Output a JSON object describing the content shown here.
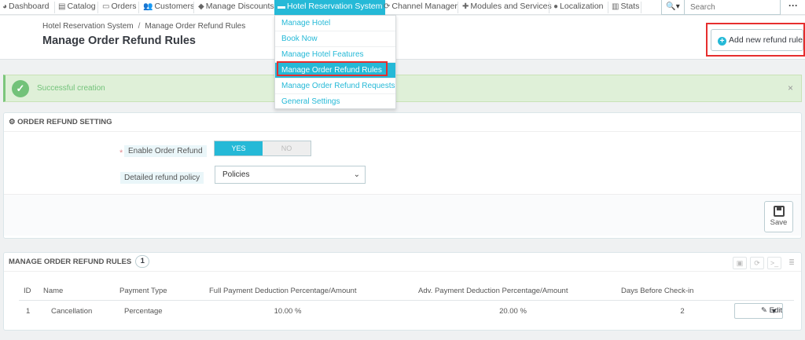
{
  "nav": {
    "items": [
      {
        "label": "Dashboard",
        "icon": "dashboard-icon",
        "glyph": "◕"
      },
      {
        "label": "Catalog",
        "icon": "catalog-icon",
        "glyph": "▤"
      },
      {
        "label": "Orders",
        "icon": "orders-icon",
        "glyph": "▭"
      },
      {
        "label": "Customers",
        "icon": "customers-icon",
        "glyph": "👥"
      },
      {
        "label": "Manage Discounts",
        "icon": "tag-icon",
        "glyph": "◆"
      },
      {
        "label": "Hotel Reservation System",
        "icon": "bed-icon",
        "glyph": "▬"
      },
      {
        "label": "Channel Manager",
        "icon": "refresh-icon",
        "glyph": "⟳"
      },
      {
        "label": "Modules and Services",
        "icon": "puzzle-icon",
        "glyph": "✚"
      },
      {
        "label": "Localization",
        "icon": "globe-icon",
        "glyph": "●"
      },
      {
        "label": "Stats",
        "icon": "bar-chart-icon",
        "glyph": "▥"
      }
    ],
    "search_placeholder": "Search",
    "search_icon": "🔍▾",
    "more_icon": "···"
  },
  "dropdown": {
    "items": [
      "Manage Hotel",
      "Book Now",
      "Manage Hotel Features",
      "Manage Order Refund Rules",
      "Manage Order Refund Requests",
      "General Settings"
    ]
  },
  "header": {
    "breadcrumb": [
      "Hotel Reservation System",
      "Manage Order Refund Rules"
    ],
    "breadcrumb_sep": "/",
    "title": "Manage Order Refund Rules",
    "add_button": "Add new refund rule"
  },
  "alert": {
    "message": "Successful creation",
    "check": "✓",
    "close": "×"
  },
  "settings": {
    "heading": "ORDER REFUND SETTING",
    "heading_icon": "⚙",
    "enable_label": "Enable Order Refund",
    "required_mark": "*",
    "yes": "YES",
    "no": "NO",
    "policy_label": "Detailed refund policy",
    "policy_value": "Policies",
    "save": "Save"
  },
  "rules": {
    "heading": "MANAGE ORDER REFUND RULES",
    "count": "1",
    "columns": [
      "ID",
      "Name",
      "Payment Type",
      "Full Payment Deduction Percentage/Amount",
      "Adv. Payment Deduction Percentage/Amount",
      "Days Before Check-in"
    ],
    "rows": [
      {
        "id": "1",
        "name": "Cancellation",
        "payment_type": "Percentage",
        "full": "10.00 %",
        "adv": "20.00 %",
        "days": "2",
        "edit": "Edit"
      }
    ]
  },
  "colors": {
    "accent": "#25b9d7",
    "success": "#72c279",
    "highlight": "#e62e2e"
  }
}
